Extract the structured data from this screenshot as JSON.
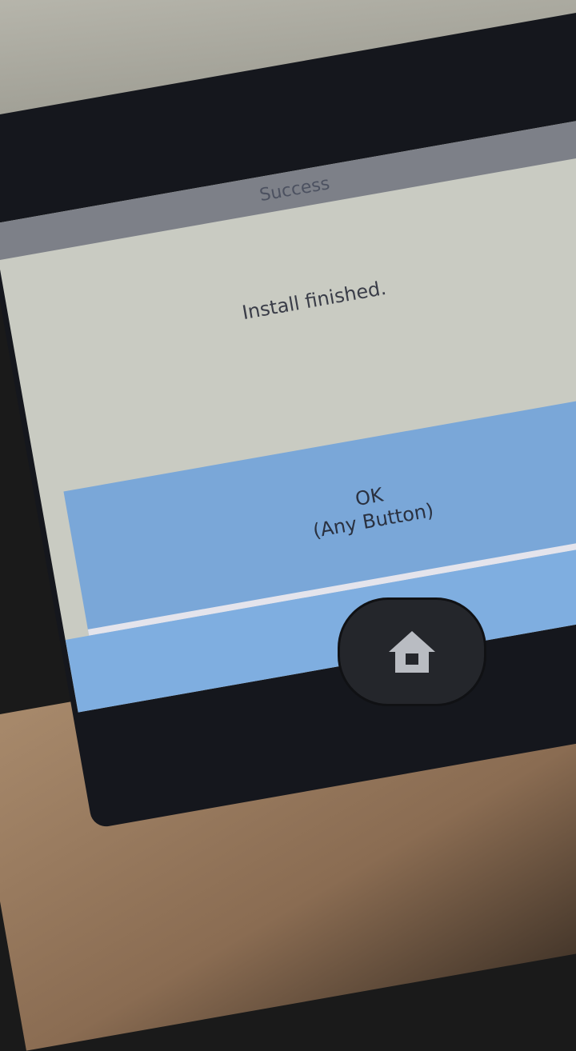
{
  "dialog": {
    "title": "Success",
    "message": "Install finished.",
    "ok_label": "OK",
    "ok_hint": "(Any Button)"
  },
  "icons": {
    "home": "home-icon"
  },
  "colors": {
    "button": "#7aa7d8",
    "background": "#c9cbc2",
    "titlebar": "#7d8088"
  }
}
